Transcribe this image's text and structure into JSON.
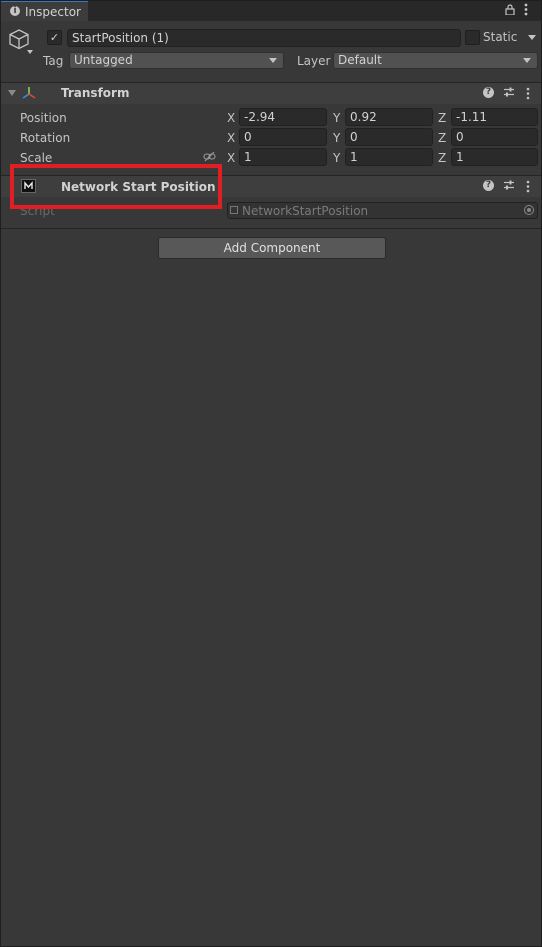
{
  "tab": {
    "label": "Inspector"
  },
  "gameobject": {
    "active": true,
    "name": "StartPosition (1)",
    "static_label": "Static",
    "tag_label": "Tag",
    "tag_value": "Untagged",
    "layer_label": "Layer",
    "layer_value": "Default"
  },
  "transform": {
    "title": "Transform",
    "position": {
      "label": "Position",
      "x": "-2.94",
      "y": "0.92",
      "z": "-1.11"
    },
    "rotation": {
      "label": "Rotation",
      "x": "0",
      "y": "0",
      "z": "0"
    },
    "scale": {
      "label": "Scale",
      "x": "1",
      "y": "1",
      "z": "1"
    },
    "axis_x": "X",
    "axis_y": "Y",
    "axis_z": "Z"
  },
  "network_start_position": {
    "title": "Network Start Position",
    "script_label": "Script",
    "script_value": "NetworkStartPosition"
  },
  "add_component_label": "Add Component",
  "colors": {
    "highlight": "#e01e24",
    "accent": "#3a79bb"
  }
}
